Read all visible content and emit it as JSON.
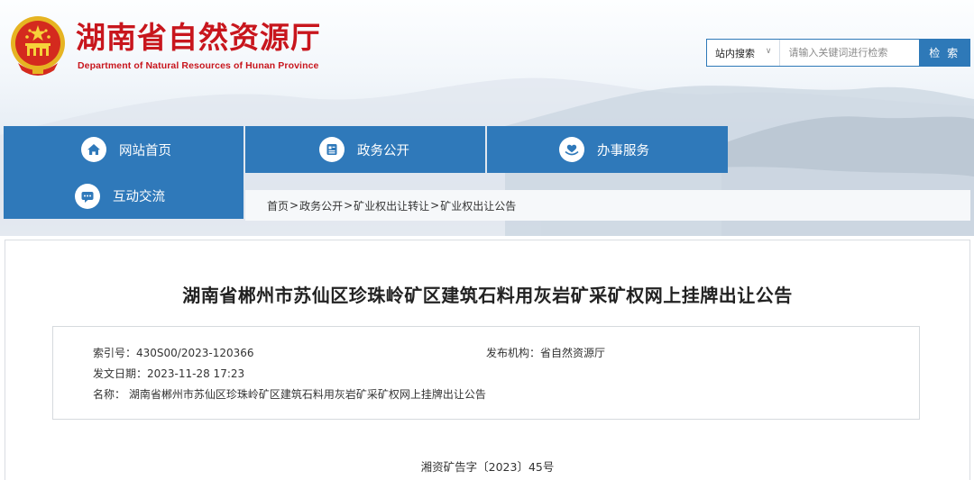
{
  "header": {
    "title": "湖南省自然资源厅",
    "subtitle": "Department of Natural Resources of Hunan Province"
  },
  "search": {
    "scope": "站内搜索",
    "placeholder": "请输入关键词进行检索",
    "button": "检 索"
  },
  "nav": {
    "items": [
      {
        "label": "网站首页",
        "icon": "home-icon"
      },
      {
        "label": "政务公开",
        "icon": "document-icon"
      },
      {
        "label": "办事服务",
        "icon": "heart-hand-icon"
      },
      {
        "label": "互动交流",
        "icon": "chat-bubble-icon"
      }
    ]
  },
  "breadcrumb": {
    "items": [
      "首页",
      "政务公开",
      "矿业权出让转让",
      "矿业权出让公告"
    ],
    "separator": ">"
  },
  "article": {
    "title": "湖南省郴州市苏仙区珍珠岭矿区建筑石料用灰岩矿采矿权网上挂牌出让公告",
    "meta": {
      "index_no": "索引号：430S00/2023-120366",
      "publisher": "发布机构：省自然资源厅",
      "date": "发文日期：2023-11-28 17:23",
      "name": "名称： 湖南省郴州市苏仙区珍珠岭矿区建筑石料用灰岩矿采矿权网上挂牌出让公告"
    },
    "doc_number": "湘资矿告字〔2023〕45号"
  },
  "colors": {
    "brand_red": "#c8161d",
    "nav_blue": "#2f79ba",
    "search_blue": "#2e79b8"
  }
}
